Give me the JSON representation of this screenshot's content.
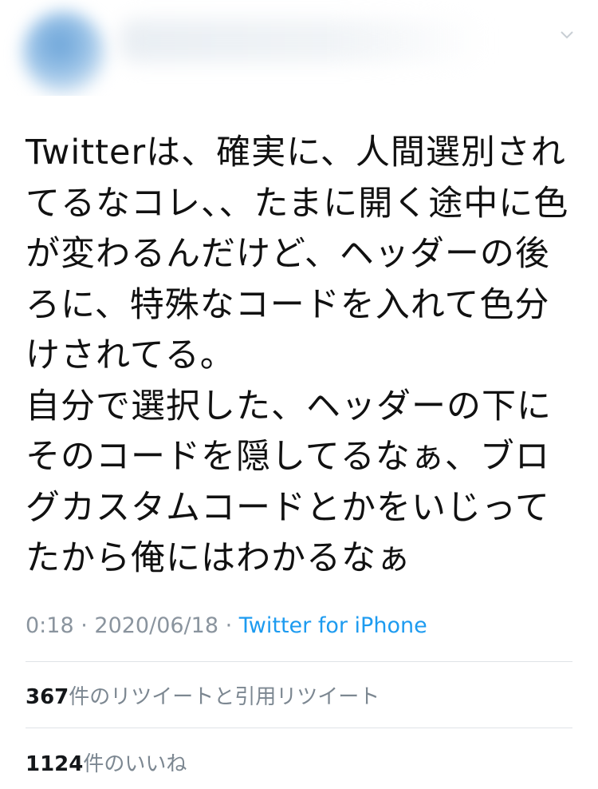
{
  "header": {
    "chevron_icon": "chevron-down-icon"
  },
  "tweet": {
    "text": "Twitterは、確実に、人間選別されてるなコレ、、たまに開く途中に色が変わるんだけど、ヘッダーの後ろに、特殊なコードを入れて色分けされてる。\n自分で選択した、ヘッダーの下にそのコードを隠してるなぁ、ブログカスタムコードとかをいじってたから俺にはわかるなぁ",
    "time": "0:18",
    "date": "2020/06/18",
    "separator": " · ",
    "source": "Twitter for iPhone"
  },
  "stats": {
    "retweets_count": "367",
    "retweets_label": "件のリツイートと引用リツイート",
    "likes_count": "1124",
    "likes_label": "件のいいね"
  },
  "colors": {
    "link": "#1d9bf0",
    "meta": "#8a949e",
    "divider": "#dfe3e7"
  }
}
